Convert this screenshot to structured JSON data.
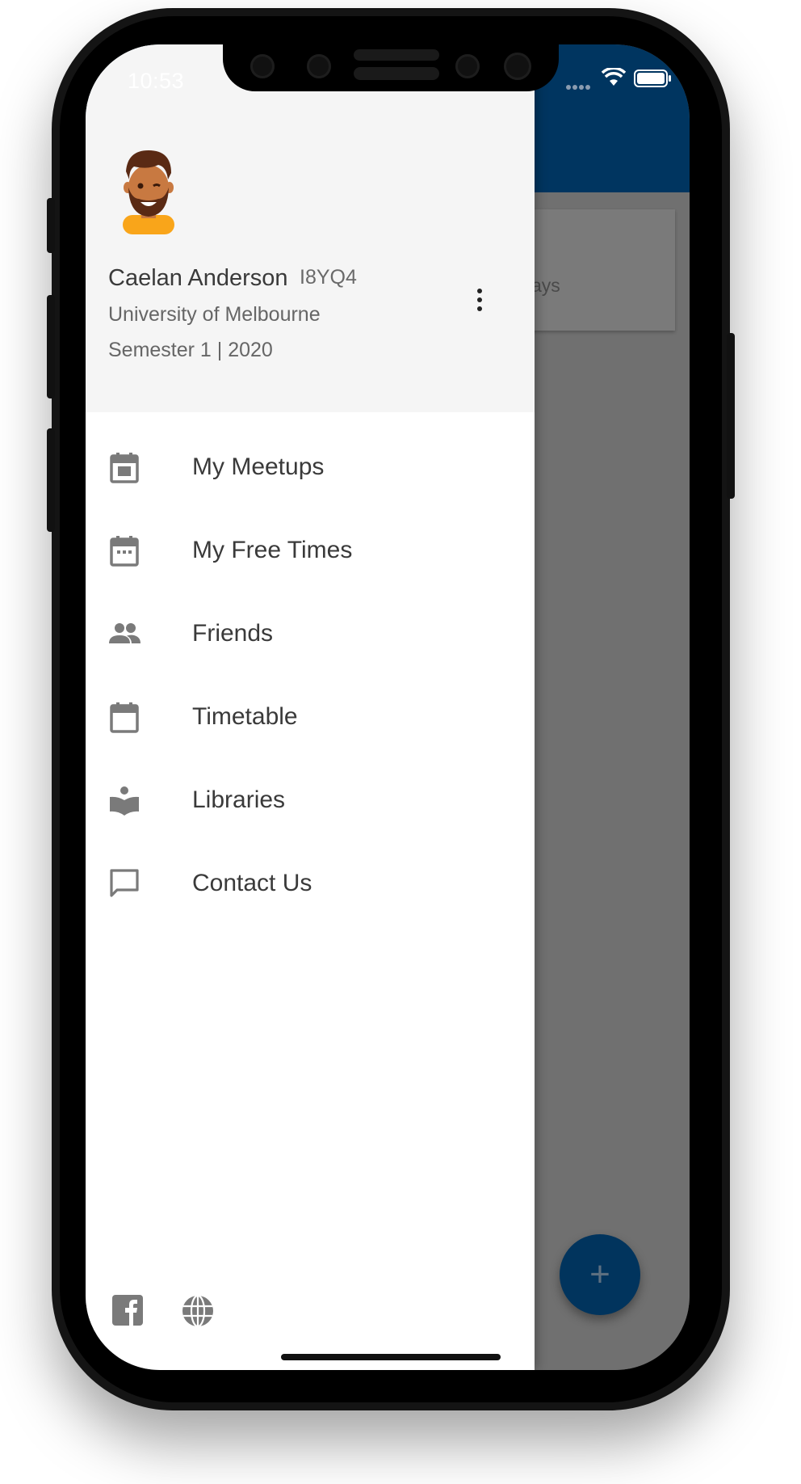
{
  "status_bar": {
    "time": "10:53"
  },
  "background_app": {
    "card_text": "ays",
    "fab_label": "+"
  },
  "profile": {
    "name": "Caelan Anderson",
    "code": "I8YQ4",
    "university": "University of Melbourne",
    "semester": "Semester 1 | 2020"
  },
  "menu": [
    {
      "label": "My Meetups",
      "icon": "calendar-event-icon"
    },
    {
      "label": "My Free Times",
      "icon": "calendar-dots-icon"
    },
    {
      "label": "Friends",
      "icon": "people-icon"
    },
    {
      "label": "Timetable",
      "icon": "calendar-icon"
    },
    {
      "label": "Libraries",
      "icon": "book-reader-icon"
    },
    {
      "label": "Contact Us",
      "icon": "chat-bubble-icon"
    }
  ],
  "footer": {
    "icons": [
      "facebook-icon",
      "globe-icon"
    ]
  },
  "colors": {
    "app_bar": "#003560",
    "fab": "#01345d",
    "drawer_header": "#f5f5f5",
    "icon_gray": "#7a7a7a"
  }
}
